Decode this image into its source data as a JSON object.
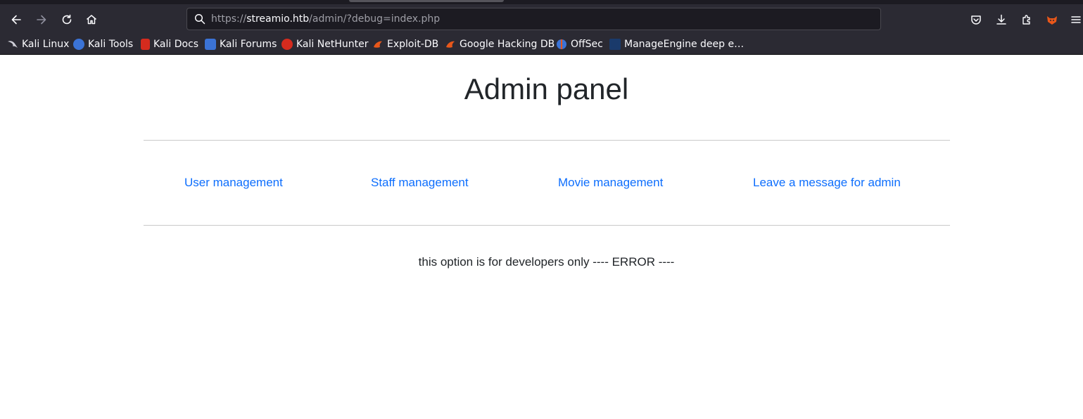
{
  "browser": {
    "url_host": "streamio.htb",
    "url_scheme": "https://",
    "url_path": "/admin/?debug=index.php",
    "bookmarks": [
      {
        "label": "Kali Linux",
        "color": "#1a1a1a"
      },
      {
        "label": "Kali Tools",
        "color": "#3b73d6"
      },
      {
        "label": "Kali Docs",
        "color": "#d52b1e"
      },
      {
        "label": "Kali Forums",
        "color": "#3b73d6"
      },
      {
        "label": "Kali NetHunter",
        "color": "#d52b1e"
      },
      {
        "label": "Exploit-DB",
        "color": "#e8571a"
      },
      {
        "label": "Google Hacking DB",
        "color": "#e8571a"
      },
      {
        "label": "OffSec",
        "color": "#3b73d6"
      },
      {
        "label": "ManageEngine deep e…",
        "color": "#1a3a6b"
      }
    ]
  },
  "page": {
    "title": "Admin panel",
    "nav": [
      {
        "label": "User management"
      },
      {
        "label": "Staff management"
      },
      {
        "label": "Movie management"
      },
      {
        "label": "Leave a message for admin"
      }
    ],
    "message": "this option is for developers only ---- ERROR ----"
  },
  "colors": {
    "link": "#0d6efd",
    "chrome": "#2b2a33",
    "urlbar": "#1c1b22"
  }
}
